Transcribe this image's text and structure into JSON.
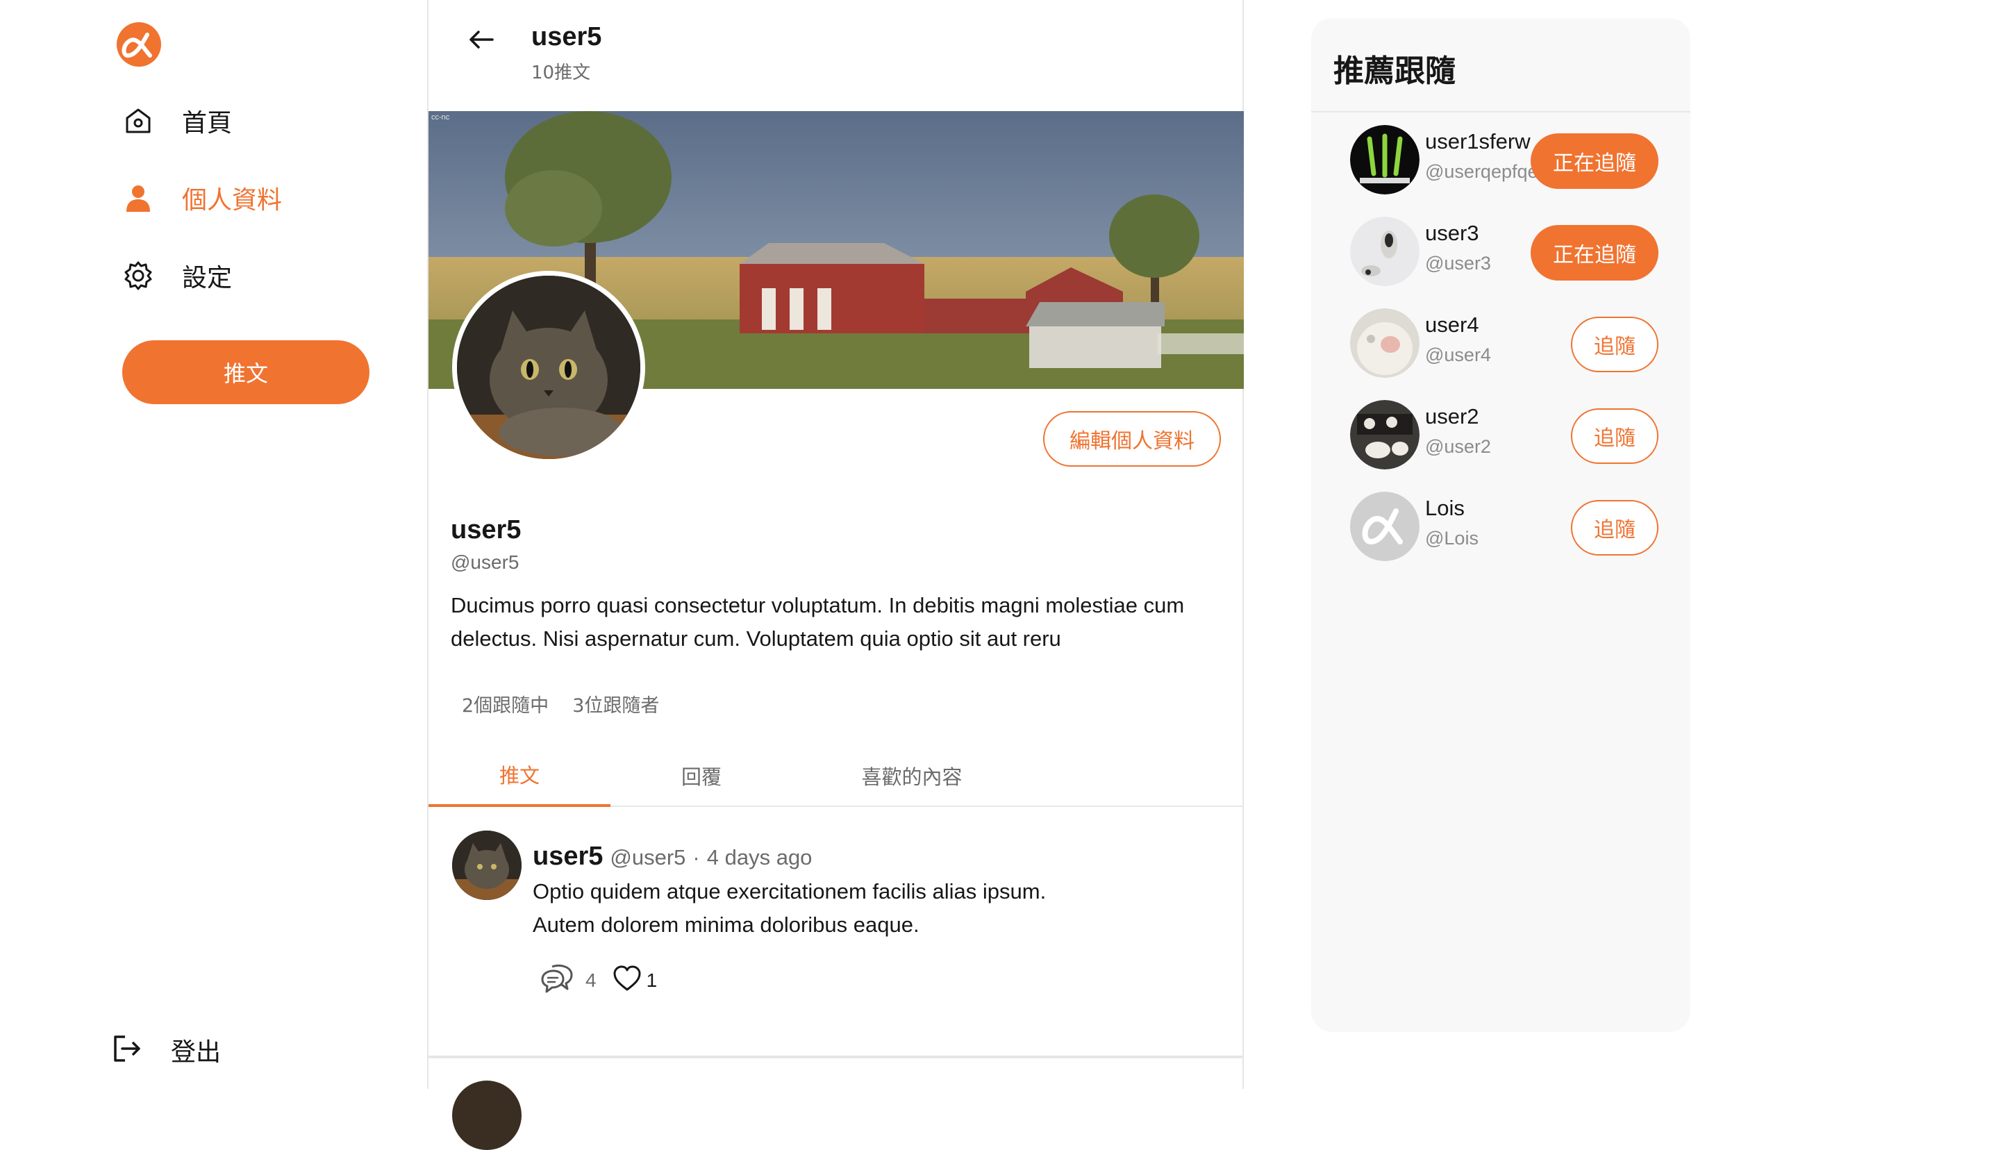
{
  "sidebar": {
    "items": [
      {
        "label": "首頁",
        "icon": "home-icon"
      },
      {
        "label": "個人資料",
        "icon": "user-icon"
      },
      {
        "label": "設定",
        "icon": "gear-icon"
      }
    ],
    "tweet_button": "推文",
    "logout_label": "登出"
  },
  "header": {
    "title": "user5",
    "tweet_count": "10推文"
  },
  "profile": {
    "cover_watermark": "cc-nc",
    "name": "user5",
    "handle": "@user5",
    "bio": "Ducimus porro quasi consectetur voluptatum. In debitis magni molestiae cum delectus. Nisi aspernatur cum. Voluptatem quia optio sit aut reru",
    "edit_button": "編輯個人資料",
    "following": "2個跟隨中",
    "followers": "3位跟隨者"
  },
  "tabs": [
    {
      "label": "推文",
      "active": true
    },
    {
      "label": "回覆",
      "active": false
    },
    {
      "label": "喜歡的內容",
      "active": false
    }
  ],
  "tweets": [
    {
      "name": "user5",
      "handle": "@user5",
      "separator": "·",
      "time": "4 days ago",
      "body_line1": "Optio quidem atque exercitationem facilis alias ipsum.",
      "body_line2": "Autem dolorem minima doloribus eaque.",
      "reply_count": "4",
      "like_count": "1"
    }
  ],
  "recommend": {
    "title": "推薦跟隨",
    "users": [
      {
        "name": "user1sferw",
        "handle": "@userqepfqe",
        "button": "正在追隨",
        "following": true
      },
      {
        "name": "user3",
        "handle": "@user3",
        "button": "正在追隨",
        "following": true
      },
      {
        "name": "user4",
        "handle": "@user4",
        "button": "追隨",
        "following": false
      },
      {
        "name": "user2",
        "handle": "@user2",
        "button": "追隨",
        "following": false
      },
      {
        "name": "Lois",
        "handle": "@Lois",
        "button": "追隨",
        "following": false
      }
    ]
  },
  "colors": {
    "accent": "#f07330",
    "text": "#171717",
    "muted": "#6b6b6b",
    "border": "#e6e6e6",
    "panel": "#f8f8f8"
  }
}
